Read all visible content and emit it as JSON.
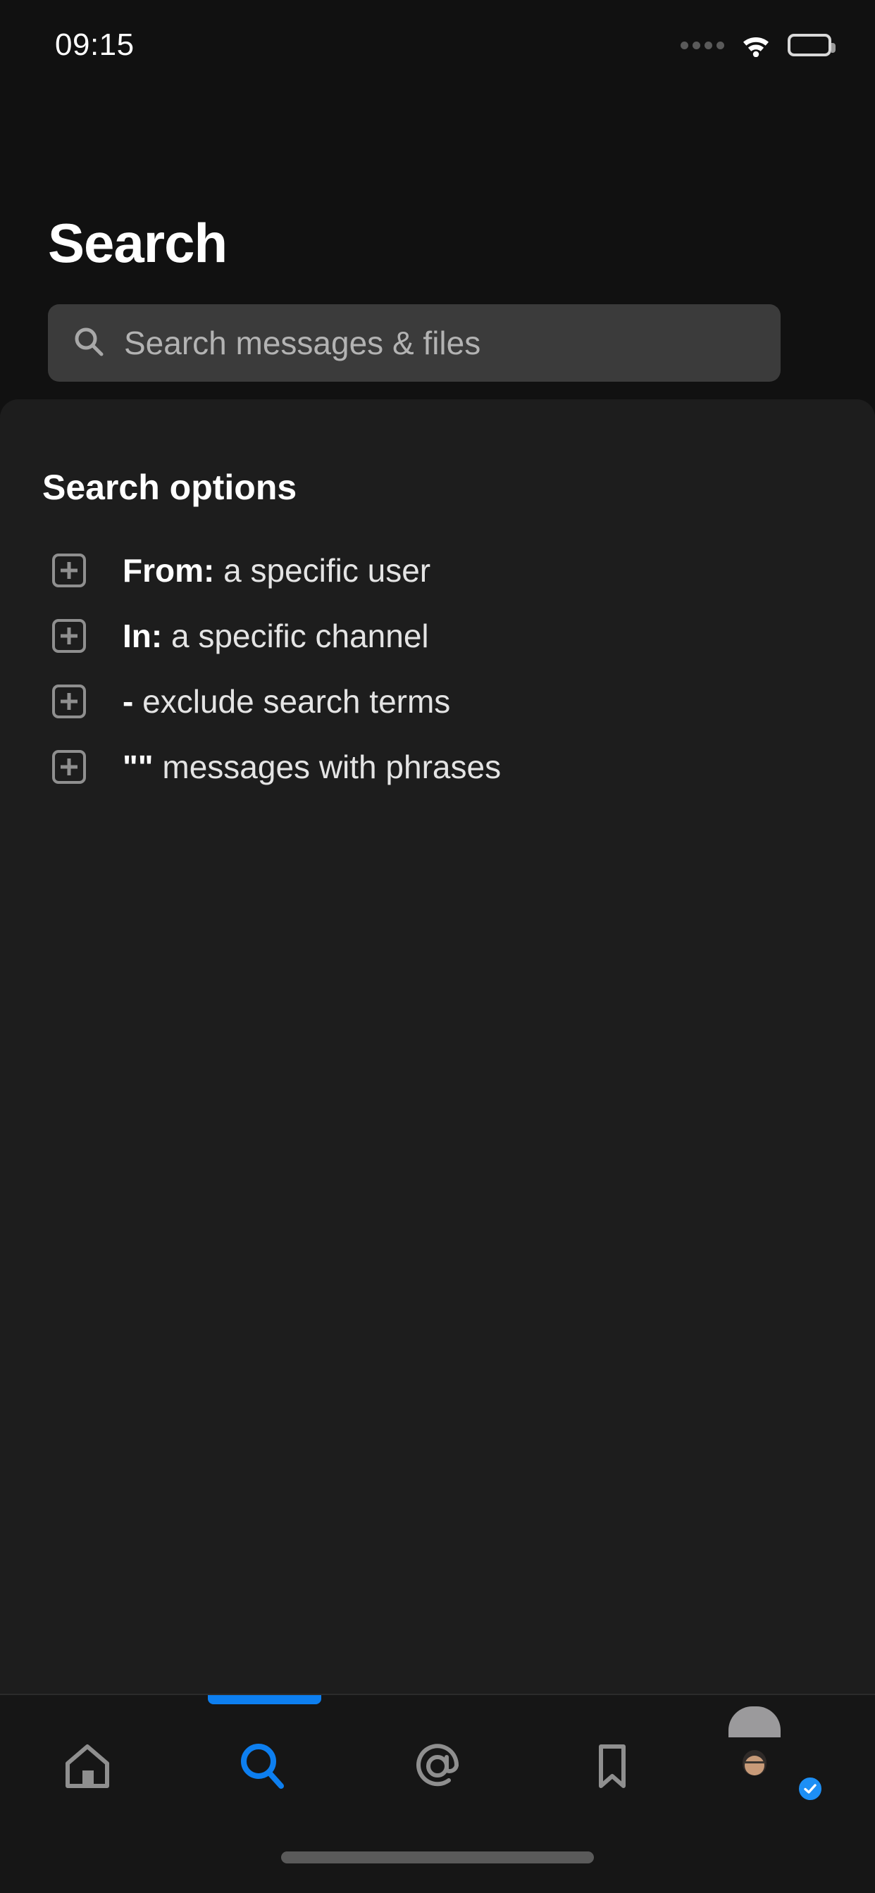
{
  "status_bar": {
    "time": "09:15",
    "signal_icon": "signal-dots-icon",
    "wifi_icon": "wifi-icon",
    "battery_icon": "battery-full-icon"
  },
  "header": {
    "title": "Search"
  },
  "search": {
    "icon": "search-icon",
    "value": "",
    "placeholder": "Search messages & files"
  },
  "options_panel": {
    "title": "Search options",
    "items": [
      {
        "icon": "plus-box-icon",
        "prefix": "From:",
        "label": " a specific user"
      },
      {
        "icon": "plus-box-icon",
        "prefix": "In:",
        "label": " a specific channel"
      },
      {
        "icon": "plus-box-icon",
        "prefix": "-",
        "label": " exclude search terms"
      },
      {
        "icon": "plus-box-icon",
        "prefix": "\"\"",
        "label": " messages with phrases"
      }
    ]
  },
  "bottom_nav": {
    "active_index": 1,
    "items": [
      {
        "name": "home",
        "icon": "home-icon"
      },
      {
        "name": "search",
        "icon": "search-icon"
      },
      {
        "name": "mentions",
        "icon": "at-mention-icon"
      },
      {
        "name": "saved",
        "icon": "bookmark-icon"
      },
      {
        "name": "you",
        "icon": "avatar-icon"
      }
    ]
  },
  "colors": {
    "background": "#111111",
    "panel": "#1d1d1d",
    "search_field": "#3b3b3b",
    "accent": "#0d7ff0",
    "icon_gray": "#8f8f8f",
    "text_primary": "#ffffff",
    "text_secondary": "#e4e4e4"
  }
}
